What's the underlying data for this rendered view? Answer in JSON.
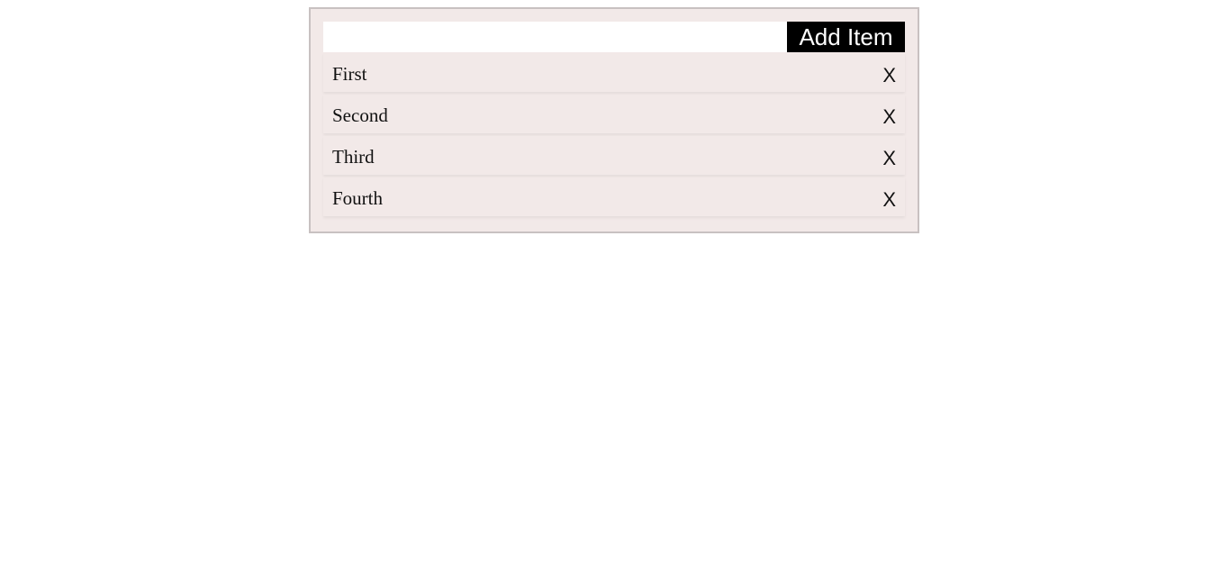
{
  "form": {
    "input_value": "",
    "input_placeholder": "",
    "add_label": "Add Item"
  },
  "items": [
    {
      "label": "First",
      "remove_label": "X"
    },
    {
      "label": "Second",
      "remove_label": "X"
    },
    {
      "label": "Third",
      "remove_label": "X"
    },
    {
      "label": "Fourth",
      "remove_label": "X"
    }
  ]
}
